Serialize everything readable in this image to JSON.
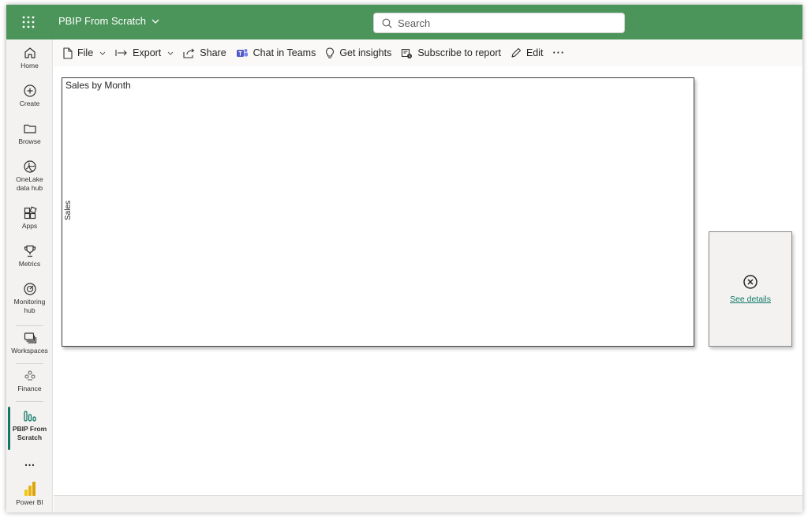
{
  "header": {
    "app_title": "PBIP From Scratch",
    "search_placeholder": "Search",
    "brand_color": "#4b955a"
  },
  "sidebar": {
    "items": [
      {
        "label": "Home",
        "icon": "home-icon"
      },
      {
        "label": "Create",
        "icon": "plus-circle-icon"
      },
      {
        "label": "Browse",
        "icon": "folder-icon"
      },
      {
        "label": "OneLake data hub",
        "icon": "onelake-icon"
      },
      {
        "label": "Apps",
        "icon": "apps-icon"
      },
      {
        "label": "Metrics",
        "icon": "trophy-icon"
      },
      {
        "label": "Monitoring hub",
        "icon": "monitoring-icon"
      },
      {
        "label": "Workspaces",
        "icon": "workspaces-icon"
      },
      {
        "label": "Finance",
        "icon": "finance-icon"
      },
      {
        "label": "PBIP From Scratch",
        "icon": "report-icon"
      },
      {
        "label": "…",
        "icon": "more-icon"
      },
      {
        "label": "Power BI",
        "icon": "powerbi-icon"
      }
    ],
    "active_color": "#117865"
  },
  "toolbar": {
    "file": "File",
    "export": "Export",
    "share": "Share",
    "chat_in_teams": "Chat in Teams",
    "get_insights": "Get insights",
    "subscribe": "Subscribe to report",
    "edit": "Edit",
    "more": "···"
  },
  "report": {
    "visual_title": "Sales by Month",
    "y_axis_label": "Sales",
    "error_link": "See details"
  }
}
